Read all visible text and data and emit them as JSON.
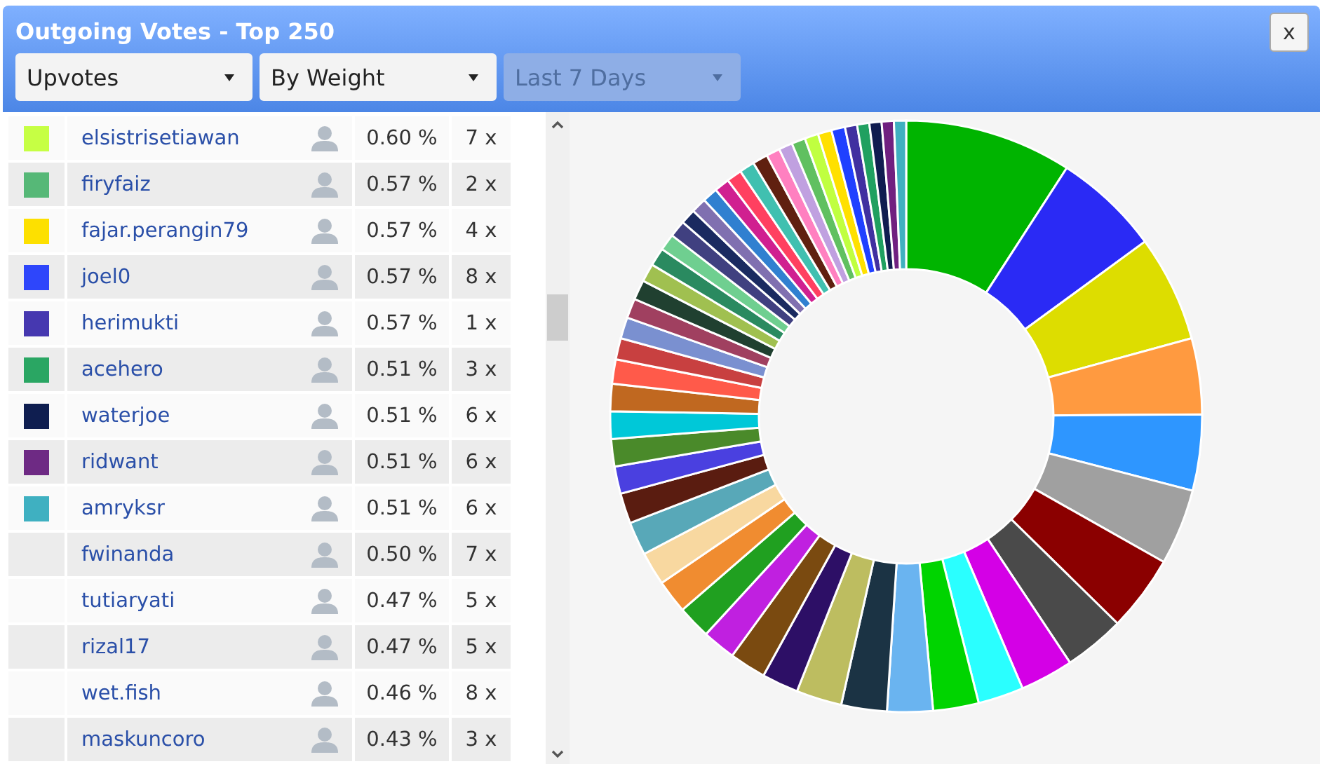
{
  "window": {
    "title": "Outgoing Votes - Top 250",
    "close_label": "x"
  },
  "filters": [
    {
      "value": "Upvotes",
      "disabled": false
    },
    {
      "value": "By Weight",
      "disabled": false
    },
    {
      "value": "Last 7 Days",
      "disabled": true
    }
  ],
  "table": {
    "rows": [
      {
        "color": "#c6ff44",
        "name": "elsistrisetiawan",
        "share": "0.60 %",
        "count": "7 x"
      },
      {
        "color": "#56b877",
        "name": "firyfaiz",
        "share": "0.57 %",
        "count": "2 x"
      },
      {
        "color": "#fde000",
        "name": "fajar.perangin79",
        "share": "0.57 %",
        "count": "4 x"
      },
      {
        "color": "#2e46fb",
        "name": "joel0",
        "share": "0.57 %",
        "count": "8 x"
      },
      {
        "color": "#4638b0",
        "name": "herimukti",
        "share": "0.57 %",
        "count": "1 x"
      },
      {
        "color": "#2aa663",
        "name": "acehero",
        "share": "0.51 %",
        "count": "3 x"
      },
      {
        "color": "#0f1e50",
        "name": "waterjoe",
        "share": "0.51 %",
        "count": "6 x"
      },
      {
        "color": "#6e2a84",
        "name": "ridwant",
        "share": "0.51 %",
        "count": "6 x"
      },
      {
        "color": "#3fb0c1",
        "name": "amryksr",
        "share": "0.51 %",
        "count": "6 x"
      },
      {
        "name": "fwinanda",
        "share": "0.50 %",
        "count": "7 x"
      },
      {
        "name": "tutiaryati",
        "share": "0.47 %",
        "count": "5 x"
      },
      {
        "name": "rizal17",
        "share": "0.47 %",
        "count": "5 x"
      },
      {
        "name": "wet.fish",
        "share": "0.46 %",
        "count": "8 x"
      },
      {
        "name": "maskuncoro",
        "share": "0.43 %",
        "count": "3 x"
      }
    ]
  }
}
